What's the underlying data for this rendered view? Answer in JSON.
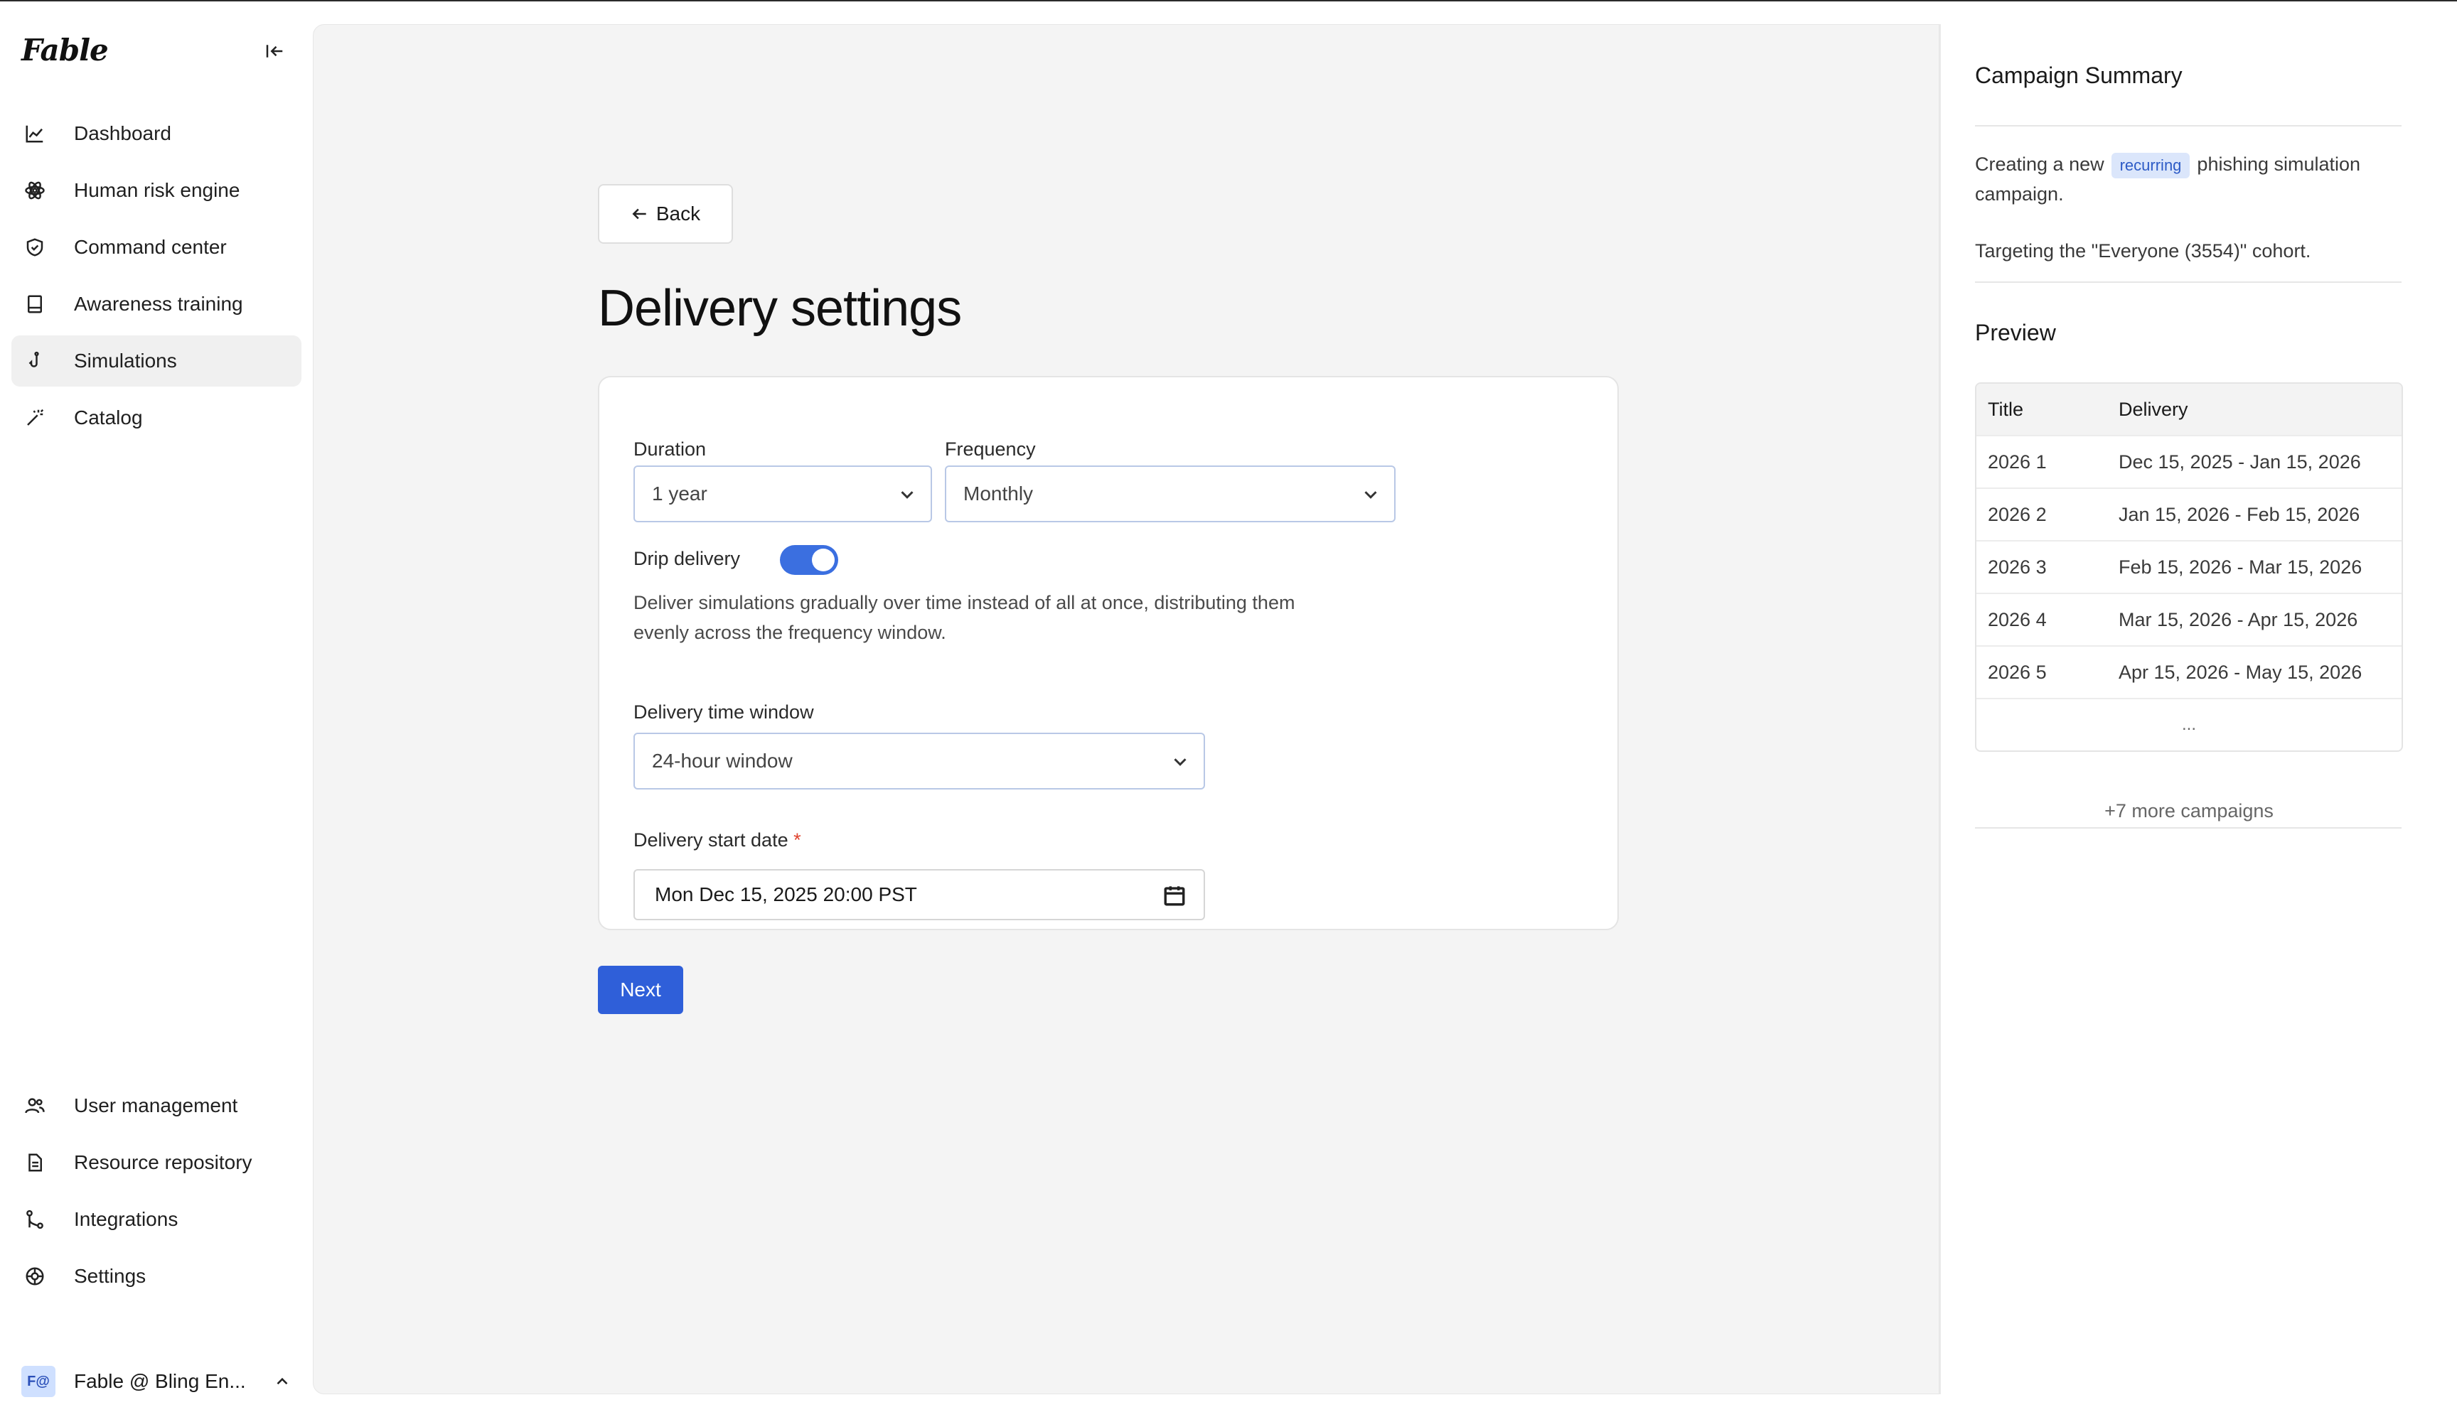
{
  "app": {
    "logo_text": "Fable"
  },
  "sidebar": {
    "top_items": [
      {
        "label": "Dashboard",
        "icon": "chart-line-icon"
      },
      {
        "label": "Human risk engine",
        "icon": "atom-icon"
      },
      {
        "label": "Command center",
        "icon": "shield-check-icon"
      },
      {
        "label": "Awareness training",
        "icon": "book-icon"
      },
      {
        "label": "Simulations",
        "icon": "fishhook-icon",
        "active": true
      },
      {
        "label": "Catalog",
        "icon": "magic-wand-icon"
      }
    ],
    "bottom_items": [
      {
        "label": "User management",
        "icon": "users-icon"
      },
      {
        "label": "Resource repository",
        "icon": "document-icon"
      },
      {
        "label": "Integrations",
        "icon": "git-merge-icon"
      },
      {
        "label": "Settings",
        "icon": "gear-icon"
      }
    ],
    "account": {
      "badge": "F@",
      "name": "Fable @ Bling En..."
    }
  },
  "main": {
    "back_label": "Back",
    "title": "Delivery settings",
    "duration": {
      "label": "Duration",
      "value": "1 year"
    },
    "frequency": {
      "label": "Frequency",
      "value": "Monthly"
    },
    "drip": {
      "label": "Drip delivery",
      "enabled": true,
      "description": "Deliver simulations gradually over time instead of all at once, distributing them evenly across the frequency window."
    },
    "time_window": {
      "label": "Delivery time window",
      "value": "24-hour window"
    },
    "start_date": {
      "label": "Delivery start date",
      "required_mark": "*",
      "value": "Mon Dec 15, 2025 20:00 PST"
    },
    "next_label": "Next"
  },
  "summary": {
    "title": "Campaign Summary",
    "text_before": "Creating a new",
    "pill": "recurring",
    "text_after": "phishing simulation campaign.",
    "cohort": "Targeting the \"Everyone (3554)\" cohort.",
    "preview_title": "Preview",
    "columns": [
      "Title",
      "Delivery"
    ],
    "rows": [
      {
        "title": "2026 1",
        "delivery": "Dec 15, 2025 - Jan 15, 2026"
      },
      {
        "title": "2026 2",
        "delivery": "Jan 15, 2026 - Feb 15, 2026"
      },
      {
        "title": "2026 3",
        "delivery": "Feb 15, 2026 - Mar 15, 2026"
      },
      {
        "title": "2026 4",
        "delivery": "Mar 15, 2026 - Apr 15, 2026"
      },
      {
        "title": "2026 5",
        "delivery": "Apr 15, 2026 - May 15, 2026"
      }
    ],
    "ellipsis": "...",
    "more": "+7 more campaigns"
  },
  "colors": {
    "accent": "#2f5fd9",
    "toggle": "#3b6fe0",
    "pill_bg": "#dbe6fb",
    "required": "#e0442f"
  }
}
